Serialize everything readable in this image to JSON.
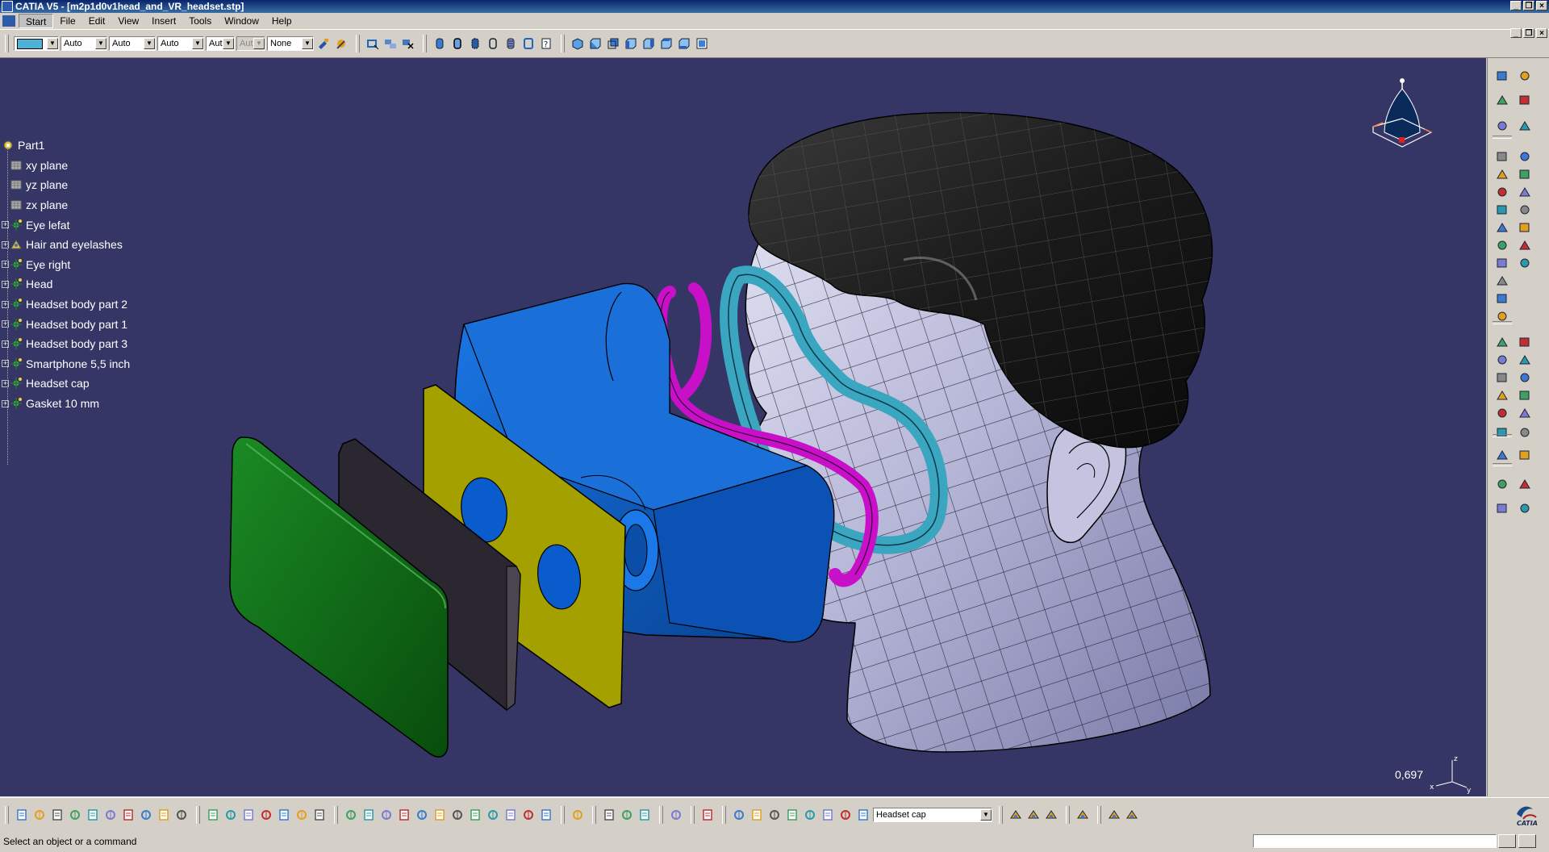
{
  "window": {
    "title": "CATIA V5 - [m2p1d0v1head_and_VR_headset.stp]",
    "buttons": [
      "minimize-icon",
      "restore-icon",
      "close-icon"
    ]
  },
  "menu": {
    "items": [
      {
        "label": "Start",
        "key": "start"
      },
      {
        "label": "File",
        "key": "file"
      },
      {
        "label": "Edit",
        "key": "edit"
      },
      {
        "label": "View",
        "key": "view"
      },
      {
        "label": "Insert",
        "key": "insert"
      },
      {
        "label": "Tools",
        "key": "tools"
      },
      {
        "label": "Window",
        "key": "window"
      },
      {
        "label": "Help",
        "key": "help"
      }
    ]
  },
  "graphic_properties": {
    "color_swatch": "#4fb0d8",
    "line_type": "Auto",
    "line_weight": "Auto",
    "transparency": "Auto",
    "layer_short": "Aut",
    "layer_disabled": "Aut",
    "render_style": "None"
  },
  "tree": {
    "root": "Part1",
    "items": [
      {
        "label": "xy plane",
        "icon": "plane-icon",
        "expandable": false
      },
      {
        "label": "yz plane",
        "icon": "plane-icon",
        "expandable": false
      },
      {
        "label": "zx plane",
        "icon": "plane-icon",
        "expandable": false
      },
      {
        "label": "Eye lefat",
        "icon": "body-icon",
        "expandable": true
      },
      {
        "label": "Hair and eyelashes",
        "icon": "geometrical-set-icon",
        "expandable": true
      },
      {
        "label": "Eye right",
        "icon": "body-icon",
        "expandable": true
      },
      {
        "label": "Head",
        "icon": "body-icon",
        "expandable": true
      },
      {
        "label": "Headset body part 2",
        "icon": "body-icon",
        "expandable": true
      },
      {
        "label": "Headset body part 1",
        "icon": "body-icon",
        "expandable": true
      },
      {
        "label": "Headset body part 3",
        "icon": "body-icon",
        "expandable": true
      },
      {
        "label": "Smartphone 5,5 inch",
        "icon": "body-icon",
        "expandable": true
      },
      {
        "label": "Headset cap",
        "icon": "body-icon",
        "expandable": true
      },
      {
        "label": "Gasket 10 mm",
        "icon": "body-icon",
        "expandable": true
      }
    ]
  },
  "viewport": {
    "background": "#353666",
    "scale": "0,697",
    "axis_labels": {
      "x": "x",
      "y": "y",
      "z": "z"
    }
  },
  "bottom_toolbar": {
    "current_body": "Headset cap"
  },
  "status": {
    "message": "Select an object or a command"
  },
  "colors": {
    "headset_cap": "#0f6a14",
    "smartphone": "#2b2730",
    "lens_plate": "#a4a000",
    "headset_body": "#0a5ccc",
    "gasket_magenta": "#c810c8",
    "gasket_cyan": "#3aa6c0",
    "hair": "#1a1a1a",
    "head": "#b4b4d6"
  }
}
